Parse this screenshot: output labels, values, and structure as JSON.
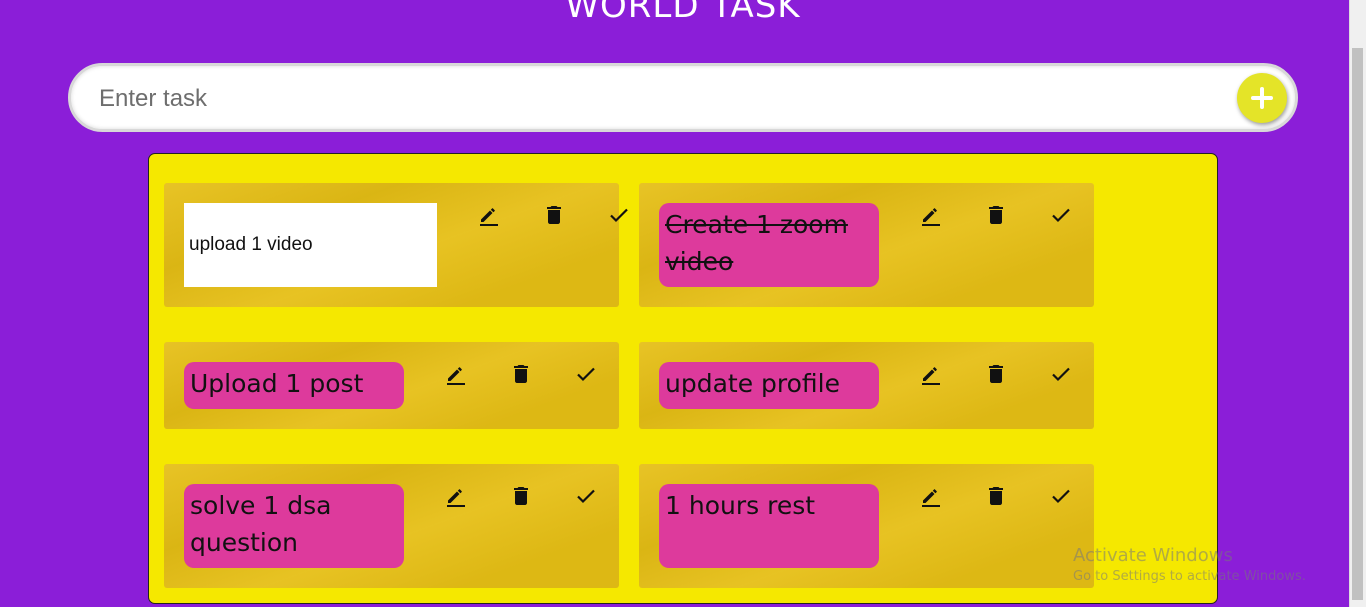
{
  "app": {
    "title": "WORLD TASK"
  },
  "form": {
    "placeholder": "Enter task",
    "add_symbol": "+"
  },
  "colors": {
    "background": "#8b1ed8",
    "board": "#f5e800",
    "card": "#e6bf15",
    "task": "#dd3a9c",
    "add_button": "#e4e428"
  },
  "tasks": [
    {
      "text": "upload 1 video",
      "editing": true,
      "completed": false
    },
    {
      "text": "Create 1 zoom video",
      "editing": false,
      "completed": true
    },
    {
      "text": "Upload 1 post",
      "editing": false,
      "completed": false
    },
    {
      "text": "update profile",
      "editing": false,
      "completed": false
    },
    {
      "text": "solve 1 dsa question",
      "editing": false,
      "completed": false
    },
    {
      "text": "1 hours rest",
      "editing": false,
      "completed": false
    }
  ],
  "icons": {
    "edit": "pencil-icon",
    "delete": "trash-icon",
    "complete": "checkmark-icon"
  },
  "watermark": {
    "line1": "Activate Windows",
    "line2": "Go to Settings to activate Windows."
  }
}
